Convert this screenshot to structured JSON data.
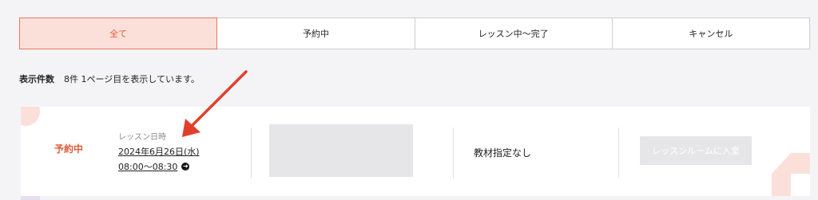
{
  "tabs": [
    {
      "label": "全て",
      "active": true
    },
    {
      "label": "予約中",
      "active": false
    },
    {
      "label": "レッスン中〜完了",
      "active": false
    },
    {
      "label": "キャンセル",
      "active": false
    }
  ],
  "results": {
    "label": "表示件数",
    "text": "8件 1ページ目を表示しています。"
  },
  "reservation": {
    "status": "予約中",
    "datetime_label": "レッスン日時",
    "date": "2024年6月26日(水)",
    "time": "08:00〜08:30",
    "time_icon": "arrow-circle-right-icon",
    "material": "教材指定なし",
    "enter_button": "レッスンルームに入室"
  },
  "colors": {
    "accent": "#e35a3a",
    "accent_light": "#fbe0da",
    "annotation_arrow": "#e0402a",
    "disabled_button": "#e6e6e8"
  }
}
